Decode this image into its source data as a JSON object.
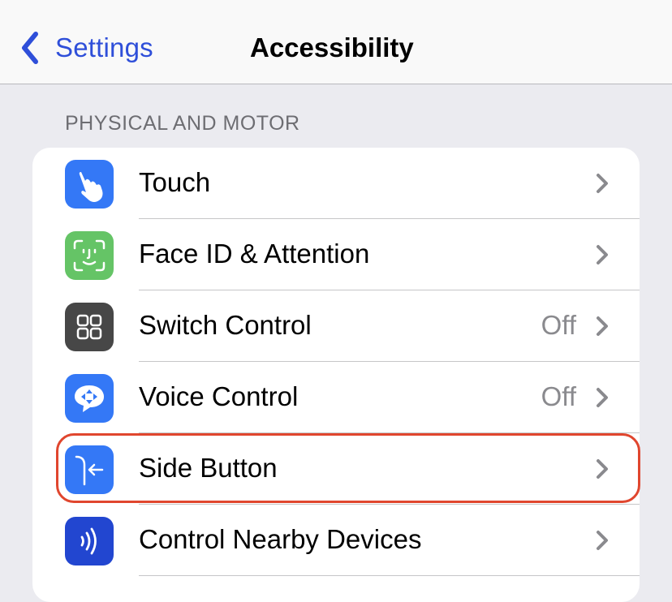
{
  "navbar": {
    "back_label": "Settings",
    "title": "Accessibility"
  },
  "section": {
    "header": "PHYSICAL AND MOTOR",
    "items": [
      {
        "label": "Touch",
        "value": "",
        "icon": "touch-hand-icon",
        "icon_color": "#3478f6"
      },
      {
        "label": "Face ID & Attention",
        "value": "",
        "icon": "face-id-icon",
        "icon_color": "#65c466"
      },
      {
        "label": "Switch Control",
        "value": "Off",
        "icon": "switch-control-grid-icon",
        "icon_color": "#474747"
      },
      {
        "label": "Voice Control",
        "value": "Off",
        "icon": "voice-control-icon",
        "icon_color": "#3478f6"
      },
      {
        "label": "Side Button",
        "value": "",
        "icon": "side-button-icon",
        "icon_color": "#3478f6"
      },
      {
        "label": "Control Nearby Devices",
        "value": "",
        "icon": "nearby-devices-icon",
        "icon_color": "#2246d0"
      }
    ]
  },
  "colors": {
    "accent": "#2f4fd9",
    "highlight_outline": "#e0462e"
  }
}
